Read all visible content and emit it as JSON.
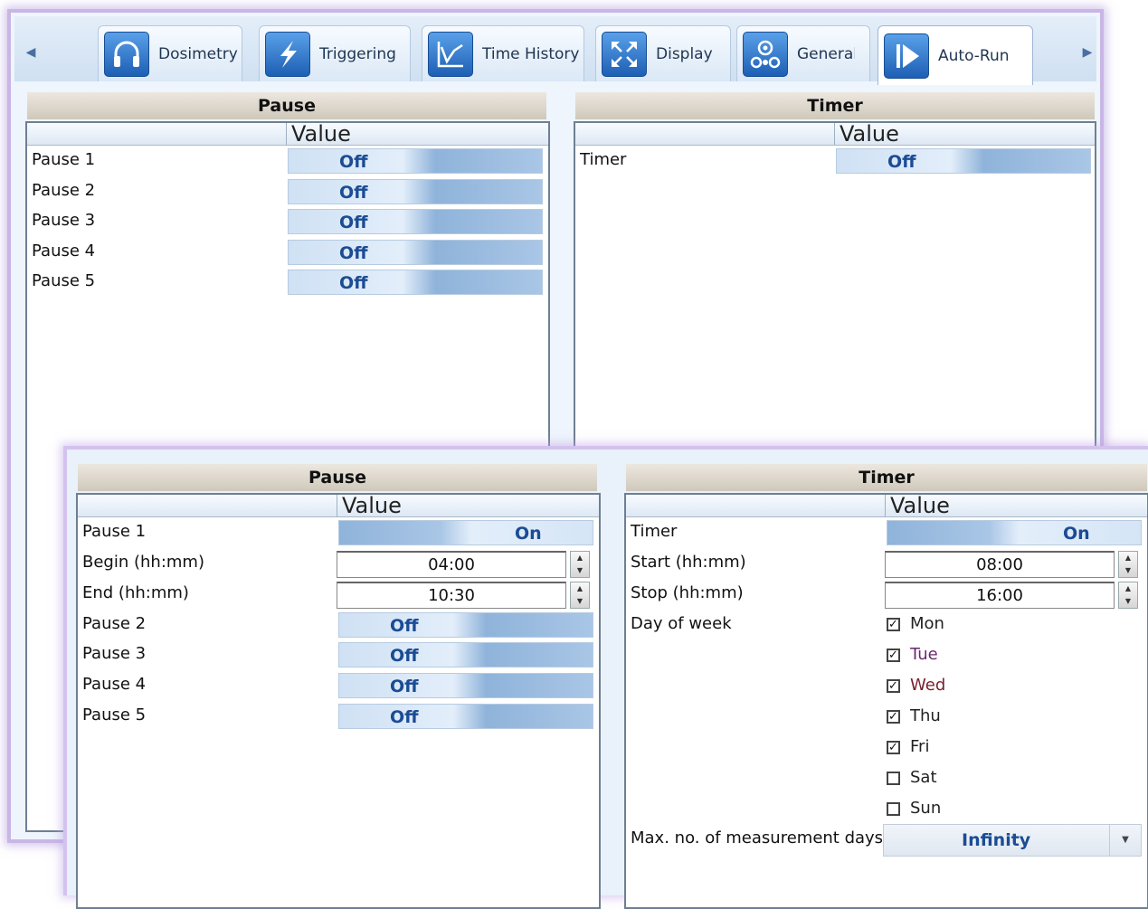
{
  "tabs": [
    {
      "label": "Dosimetry",
      "icon": "headphones-icon"
    },
    {
      "label": "Triggering",
      "icon": "lightning-icon"
    },
    {
      "label": "Time History",
      "icon": "line-graph-icon"
    },
    {
      "label": "Display",
      "icon": "expand-arrows-icon"
    },
    {
      "label": "General",
      "icon": "gears-icon"
    },
    {
      "label": "Auto-Run",
      "icon": "play-icon",
      "active": true
    }
  ],
  "back": {
    "pause": {
      "title": "Pause",
      "value_header": "Value",
      "rows": [
        {
          "label": "Pause 1",
          "value": "Off"
        },
        {
          "label": "Pause 2",
          "value": "Off"
        },
        {
          "label": "Pause 3",
          "value": "Off"
        },
        {
          "label": "Pause 4",
          "value": "Off"
        },
        {
          "label": "Pause 5",
          "value": "Off"
        }
      ]
    },
    "timer": {
      "title": "Timer",
      "value_header": "Value",
      "rows": [
        {
          "label": "Timer",
          "value": "Off"
        }
      ]
    }
  },
  "front": {
    "pause": {
      "title": "Pause",
      "value_header": "Value",
      "pause1": {
        "label": "Pause 1",
        "value": "On"
      },
      "begin": {
        "label": "Begin (hh:mm)",
        "value": "04:00"
      },
      "end": {
        "label": "End (hh:mm)",
        "value": "10:30"
      },
      "rows": [
        {
          "label": "Pause 2",
          "value": "Off"
        },
        {
          "label": "Pause 3",
          "value": "Off"
        },
        {
          "label": "Pause 4",
          "value": "Off"
        },
        {
          "label": "Pause 5",
          "value": "Off"
        }
      ]
    },
    "timer": {
      "title": "Timer",
      "value_header": "Value",
      "timer": {
        "label": "Timer",
        "value": "On"
      },
      "start": {
        "label": "Start (hh:mm)",
        "value": "08:00"
      },
      "stop": {
        "label": "Stop (hh:mm)",
        "value": "16:00"
      },
      "day_of_week_label": "Day of week",
      "days": [
        {
          "name": "Mon",
          "checked": true,
          "color": "#222222"
        },
        {
          "name": "Tue",
          "checked": true,
          "color": "#6a2a6e"
        },
        {
          "name": "Wed",
          "checked": true,
          "color": "#7a1f2e"
        },
        {
          "name": "Thu",
          "checked": true,
          "color": "#222222"
        },
        {
          "name": "Fri",
          "checked": true,
          "color": "#222222"
        },
        {
          "name": "Sat",
          "checked": false,
          "color": "#222222"
        },
        {
          "name": "Sun",
          "checked": false,
          "color": "#222222"
        }
      ],
      "max_days": {
        "label": "Max. no. of measurement days",
        "value": "Infinity"
      }
    }
  }
}
